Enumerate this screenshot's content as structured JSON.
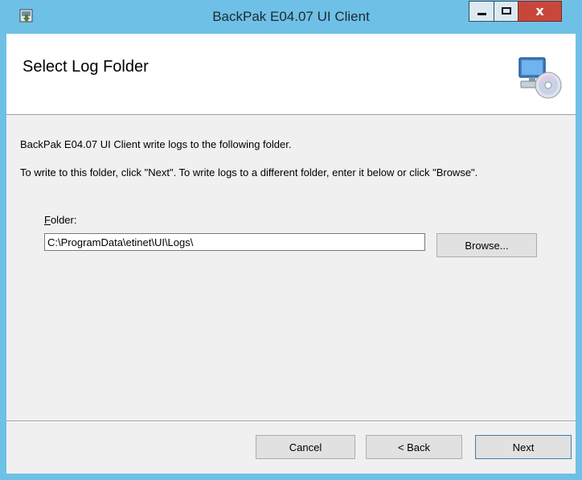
{
  "window": {
    "title": "BackPak E04.07 UI Client"
  },
  "titlebar": {
    "close_label": "x"
  },
  "banner": {
    "title": "Select Log Folder"
  },
  "body": {
    "description": "BackPak E04.07 UI Client write logs to the following folder.",
    "instructions": "To write to this folder, click \"Next\". To write logs to a different folder, enter it below or click \"Browse\".",
    "folder_label_accel": "F",
    "folder_label_rest": "older:",
    "folder_value": "C:\\ProgramData\\etinet\\UI\\Logs\\",
    "browse_label": "Browse..."
  },
  "footer": {
    "cancel_label": "Cancel",
    "back_label": "< Back",
    "next_label": "Next"
  },
  "colors": {
    "titlebar": "#6fc0e6",
    "close_button": "#c7483b",
    "client_bg": "#f0f0f0"
  },
  "icons": {
    "app": "installer-icon",
    "banner": "computer-disc-icon"
  }
}
